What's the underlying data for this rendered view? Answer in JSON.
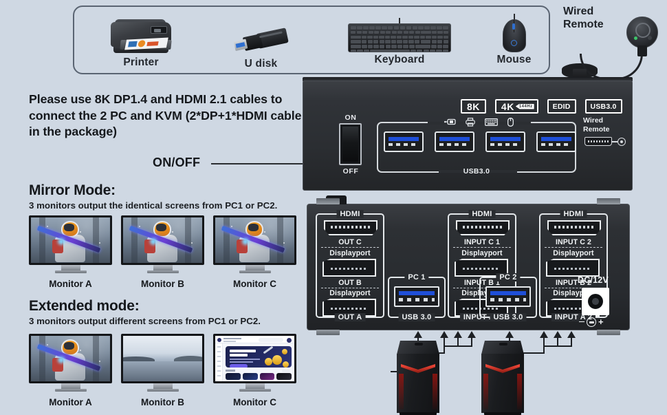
{
  "background_color": "#cfd8e3",
  "peripherals": {
    "items": [
      {
        "label": "Printer",
        "icon": "printer-icon"
      },
      {
        "label": "U disk",
        "icon": "usb-flash-drive-icon"
      },
      {
        "label": "Keyboard",
        "icon": "keyboard-icon"
      },
      {
        "label": "Mouse",
        "icon": "mouse-icon"
      }
    ]
  },
  "wired_remote": {
    "label": "Wired\nRemote",
    "label_line1": "Wired",
    "label_line2": "Remote"
  },
  "instruction": {
    "text": "Please use 8K DP1.4 and HDMI 2.1 cables to connect the 2 PC and KVM (2*DP+1*HDMI cable in the package)"
  },
  "onoff": {
    "label": "ON/OFF"
  },
  "modes": {
    "mirror": {
      "title": "Mirror Mode:",
      "subtitle": "3 monitors output the identical screens from PC1 or PC2.",
      "monitors": [
        {
          "label": "Monitor A",
          "content": "game"
        },
        {
          "label": "Monitor B",
          "content": "game"
        },
        {
          "label": "Monitor C",
          "content": "game"
        }
      ]
    },
    "extended": {
      "title": "Extended mode:",
      "subtitle": "3 monitors output different screens from PC1 or PC2.",
      "monitors": [
        {
          "label": "Monitor A",
          "content": "game"
        },
        {
          "label": "Monitor B",
          "content": "landscape"
        },
        {
          "label": "Monitor C",
          "content": "website"
        }
      ]
    }
  },
  "device_top": {
    "badges": [
      {
        "text": "8K",
        "sub": ""
      },
      {
        "text": "4K",
        "sub": "144Hz"
      },
      {
        "text": "EDID",
        "sub": ""
      },
      {
        "text": "USB3.0",
        "sub": ""
      }
    ],
    "power_switch": {
      "on_label": "ON",
      "off_label": "OFF"
    },
    "usb_hub": {
      "caption": "USB3.0",
      "icons": [
        "usb-flash-drive-icon",
        "printer-icon",
        "keyboard-icon",
        "mouse-icon"
      ],
      "port_count": 4
    },
    "remote_port": {
      "line1": "Wired",
      "line2": "Remote"
    }
  },
  "device_bottom": {
    "output_group": {
      "title": "HDMI",
      "ports": [
        {
          "label": "OUT C",
          "type": "HDMI"
        },
        {
          "label": "OUT B",
          "type": "Displayport"
        },
        {
          "label": "OUT A",
          "type": "Displayport"
        }
      ],
      "type_labels": [
        "Displayport",
        "Displayport"
      ]
    },
    "pc1_group": {
      "title": "PC 1",
      "usb_label": "USB 3.0"
    },
    "input1_group": {
      "title": "HDMI",
      "ports": [
        {
          "label": "INPUT C 1",
          "type": "HDMI"
        },
        {
          "label": "INPUT B 1",
          "type": "Displayport"
        },
        {
          "label": "INPUT A 1",
          "type": "Displayport"
        }
      ]
    },
    "pc2_group": {
      "title": "PC 2",
      "usb_label": "USB 3.0"
    },
    "input2_group": {
      "title": "HDMI",
      "ports": [
        {
          "label": "INPUT C 2",
          "type": "HDMI"
        },
        {
          "label": "INPUT B 2",
          "type": "Displayport"
        },
        {
          "label": "INPUT A 2",
          "type": "Displayport"
        }
      ]
    },
    "power": {
      "label": "DC/12V",
      "polarity": "- (+) +"
    },
    "displayport_label": "Displayport"
  },
  "towers": [
    {
      "name": "pc-tower-1"
    },
    {
      "name": "pc-tower-2"
    }
  ]
}
